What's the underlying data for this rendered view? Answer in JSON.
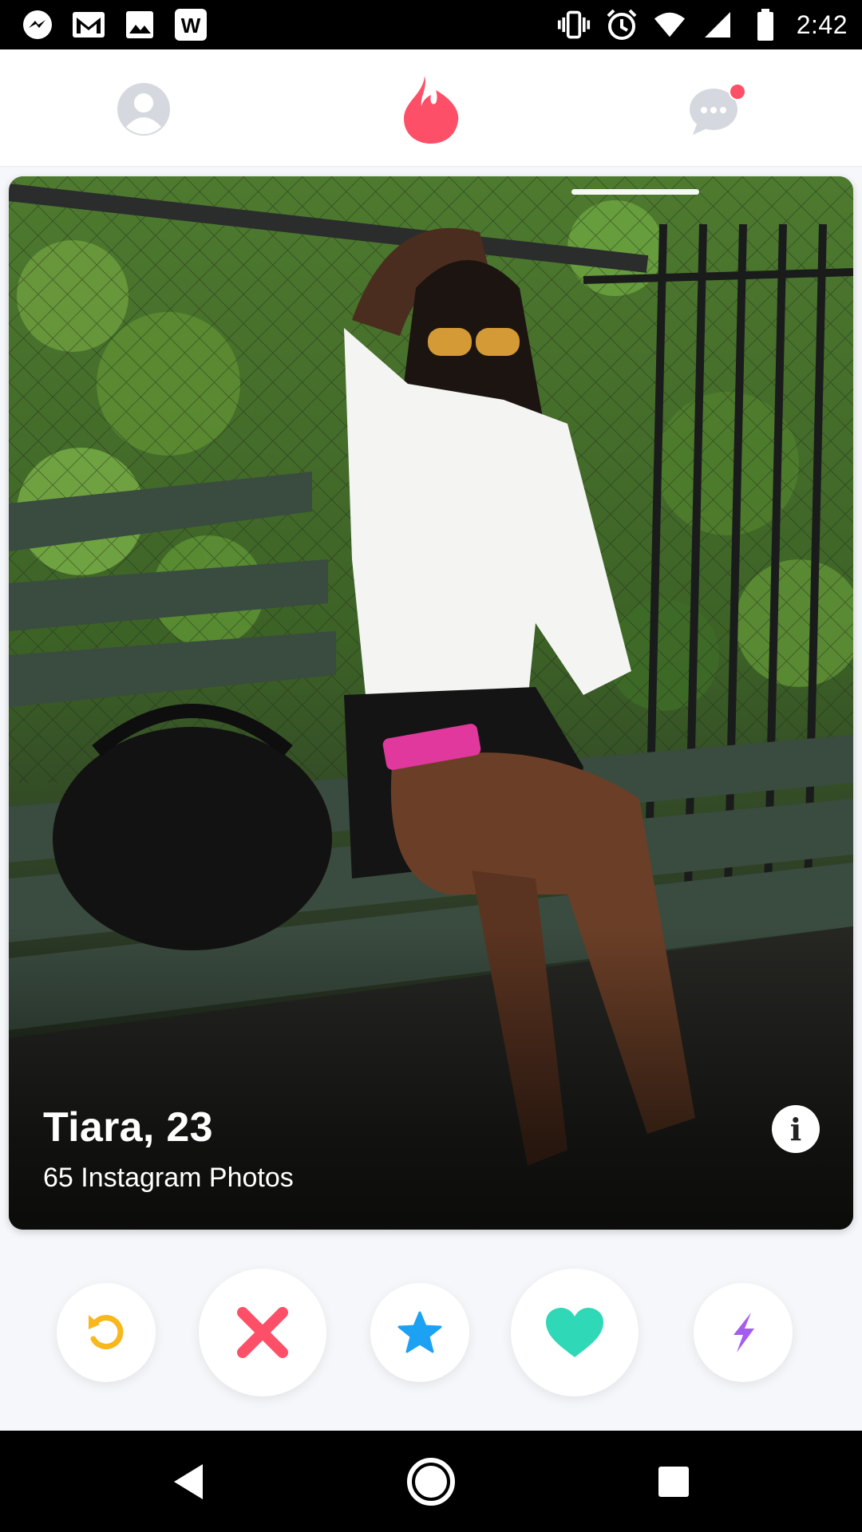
{
  "status_bar": {
    "time": "2:42",
    "left_icons": [
      "messenger-icon",
      "gmail-icon",
      "gallery-icon",
      "word-icon"
    ],
    "right_icons": [
      "vibrate-icon",
      "alarm-icon",
      "wifi-icon",
      "signal-icon",
      "battery-icon"
    ]
  },
  "header": {
    "profile_icon": "profile-icon",
    "logo_icon": "tinder-flame-icon",
    "messages_icon": "messages-icon",
    "messages_has_notification": true,
    "accent_color": "#fd5068",
    "inactive_color": "#d5d9df"
  },
  "card": {
    "name": "Tiara,",
    "age": "23",
    "subtitle": "65 Instagram Photos",
    "info_glyph": "i",
    "photo_index": 1,
    "photo_description_icon": "profile-photo"
  },
  "actions": [
    {
      "id": "rewind",
      "icon": "rewind-icon",
      "color": "#f8b71c"
    },
    {
      "id": "nope",
      "icon": "close-icon",
      "color": "#fd4f68"
    },
    {
      "id": "superlike",
      "icon": "star-icon",
      "color": "#1da1f2"
    },
    {
      "id": "like",
      "icon": "heart-icon",
      "color": "#2fd8b6"
    },
    {
      "id": "boost",
      "icon": "bolt-icon",
      "color": "#a45cf1"
    }
  ],
  "android_nav": {
    "back_icon": "back-icon",
    "home_icon": "home-icon",
    "recents_icon": "recents-icon"
  }
}
